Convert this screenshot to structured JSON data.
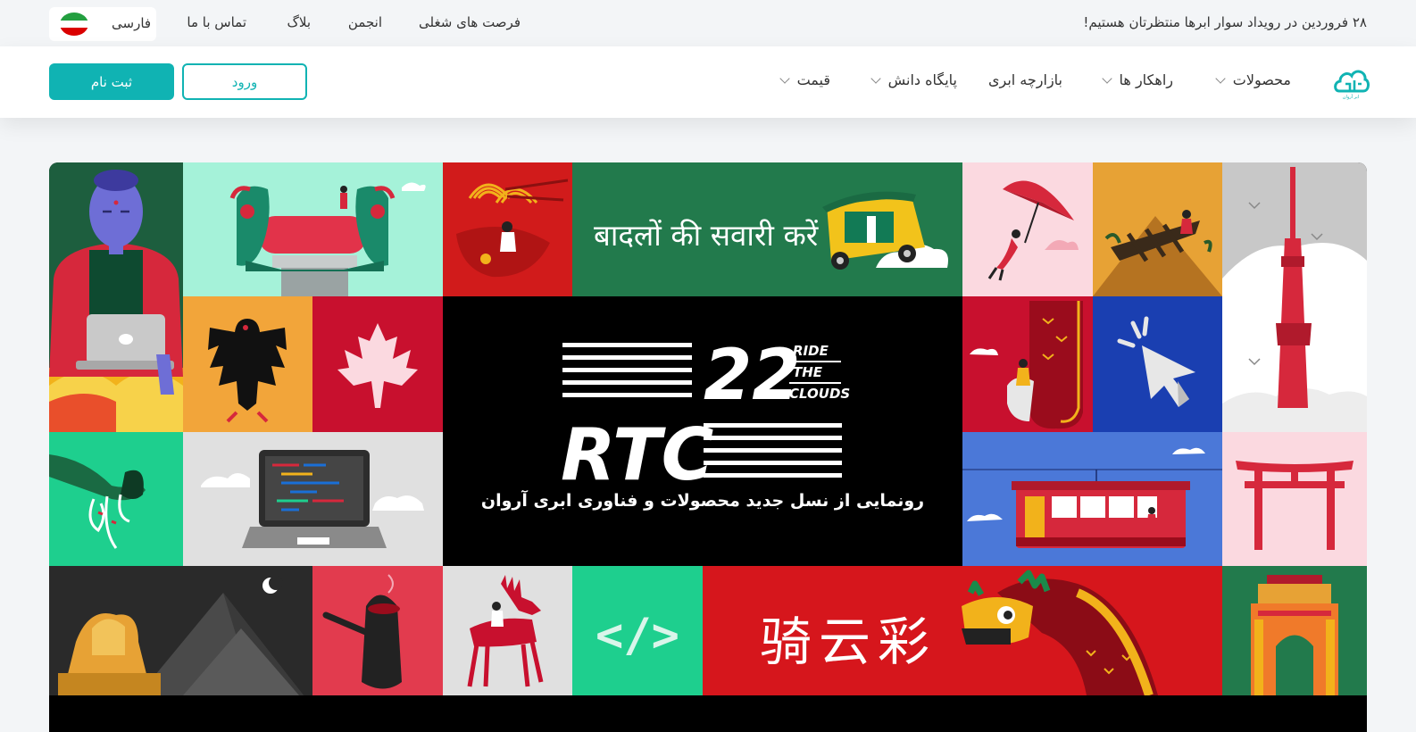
{
  "topbar": {
    "announcement": "۲۸ فروردین در رویداد سوار ابرها منتظرتان هستیم!",
    "links": [
      "فرصت های شغلی",
      "انجمن",
      "بلاگ",
      "تماس با ما"
    ],
    "language": "فارسی",
    "flag_icon": "iran-flag-icon"
  },
  "header": {
    "logo_icon": "arvan-cloud-logo",
    "nav": [
      {
        "label": "محصولات",
        "dropdown": true
      },
      {
        "label": "راهکار ها",
        "dropdown": true
      },
      {
        "label": "بازارچه ابری",
        "dropdown": false
      },
      {
        "label": "پایگاه دانش",
        "dropdown": true
      },
      {
        "label": "قیمت",
        "dropdown": true
      }
    ],
    "login_label": "ورود",
    "signup_label": "ثبت نام"
  },
  "banner": {
    "hindi_text": "बादलों की सवारी करें",
    "chinese_text": "骑云彩",
    "event_number": "22",
    "tagline_lines": [
      "RIDE",
      "THE",
      "CLOUDS"
    ],
    "event_name": "RTC",
    "subtitle": "رونمایی از نسل جدید محصولات و فناوری ابری آروان",
    "code_symbol": "</>"
  },
  "colors": {
    "accent": "#10b3b3",
    "page_bg": "#f3f5f7"
  }
}
